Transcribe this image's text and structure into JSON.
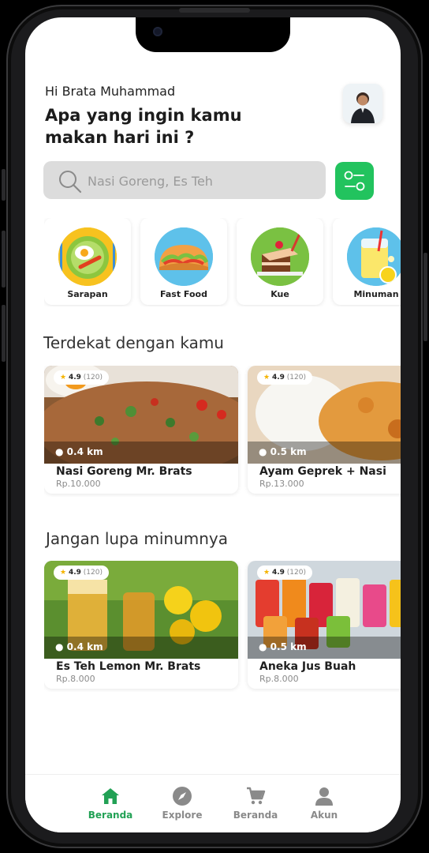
{
  "header": {
    "greeting": "Hi Brata Muhammad",
    "headline": "Apa yang ingin kamu makan hari ini ?"
  },
  "search": {
    "placeholder": "Nasi Goreng, Es Teh",
    "value": ""
  },
  "categories": [
    {
      "label": "Sarapan",
      "icon": "breakfast-plate-icon"
    },
    {
      "label": "Fast Food",
      "icon": "taco-icon"
    },
    {
      "label": "Kue",
      "icon": "cake-icon"
    },
    {
      "label": "Minuman",
      "icon": "drink-icon"
    }
  ],
  "nearby": {
    "title": "Terdekat dengan kamu",
    "items": [
      {
        "rating": "4.9",
        "count": "(120)",
        "distance": "0.4 km",
        "name": "Nasi Goreng Mr. Brats",
        "price": "Rp.10.000"
      },
      {
        "rating": "4.9",
        "count": "(120)",
        "distance": "0.5 km",
        "name": "Ayam Geprek + Nasi",
        "price": "Rp.13.000"
      }
    ]
  },
  "drinks": {
    "title": "Jangan lupa minumnya",
    "items": [
      {
        "rating": "4.9",
        "count": "(120)",
        "distance": "0.4 km",
        "name": "Es Teh Lemon Mr. Brats",
        "price": "Rp.8.000"
      },
      {
        "rating": "4.9",
        "count": "(120)",
        "distance": "0.5 km",
        "name": "Aneka Jus Buah",
        "price": "Rp.8.000"
      }
    ]
  },
  "nav": [
    {
      "label": "Beranda",
      "icon": "home-icon",
      "active": true
    },
    {
      "label": "Explore",
      "icon": "compass-icon",
      "active": false
    },
    {
      "label": "Beranda",
      "icon": "cart-icon",
      "active": false
    },
    {
      "label": "Akun",
      "icon": "user-icon",
      "active": false
    }
  ],
  "colors": {
    "accent": "#22c35e",
    "star": "#f5b400"
  }
}
